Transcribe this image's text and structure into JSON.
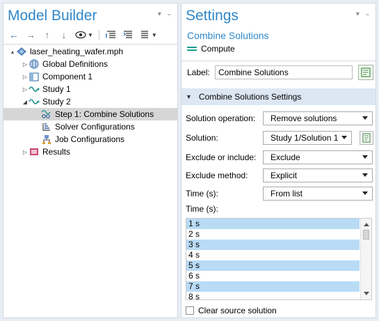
{
  "model_builder": {
    "title": "Model Builder",
    "panel_controls": "▾ ₌",
    "toolbar": [
      "back-icon",
      "forward-icon",
      "up-icon",
      "down-icon",
      "show-icon",
      "collapse-icon",
      "expand-icon",
      "more-icon"
    ],
    "tree": [
      {
        "label": "laser_heating_wafer.mph",
        "icon": "model-file-icon",
        "level": 0,
        "twisty": "▴"
      },
      {
        "label": "Global Definitions",
        "icon": "globe-icon",
        "level": 1,
        "twisty": "▷"
      },
      {
        "label": "Component 1",
        "icon": "component-icon",
        "level": 1,
        "twisty": "▷"
      },
      {
        "label": "Study 1",
        "icon": "study-icon",
        "level": 1,
        "twisty": "▷"
      },
      {
        "label": "Study 2",
        "icon": "study-icon",
        "level": 1,
        "twisty": "◢"
      },
      {
        "label": "Step 1: Combine Solutions",
        "icon": "combine-solutions-icon",
        "level": 2,
        "twisty": "",
        "selected": true
      },
      {
        "label": "Solver Configurations",
        "icon": "solver-icon",
        "level": 2,
        "twisty": ""
      },
      {
        "label": "Job Configurations",
        "icon": "job-icon",
        "level": 2,
        "twisty": ""
      },
      {
        "label": "Results",
        "icon": "results-icon",
        "level": 1,
        "twisty": "▷"
      }
    ]
  },
  "settings": {
    "title": "Settings",
    "panel_controls": "▾ ₌",
    "subtitle": "Combine Solutions",
    "compute_label": "Compute",
    "label_field": {
      "label": "Label:",
      "value": "Combine Solutions"
    },
    "section_title": "Combine Solutions Settings",
    "fields": [
      {
        "label": "Solution operation:",
        "value": "Remove solutions"
      },
      {
        "label": "Solution:",
        "value": "Study 1/Solution 1"
      },
      {
        "label": "Exclude or include:",
        "value": "Exclude"
      },
      {
        "label": "Exclude method:",
        "value": "Explicit"
      },
      {
        "label": "Time (s):",
        "value": "From list"
      }
    ],
    "time_list_label": "Time (s):",
    "time_list": [
      {
        "label": "1 s",
        "selected": true
      },
      {
        "label": "2 s",
        "selected": false
      },
      {
        "label": "3 s",
        "selected": true
      },
      {
        "label": "4 s",
        "selected": false
      },
      {
        "label": "5 s",
        "selected": true
      },
      {
        "label": "6 s",
        "selected": false
      },
      {
        "label": "7 s",
        "selected": true
      },
      {
        "label": "8 s",
        "selected": false
      }
    ],
    "clear_source_label": "Clear source solution"
  },
  "colors": {
    "accent": "#2f87c9",
    "selection": "#b9dbf6",
    "section_bg": "#dce7f3"
  }
}
